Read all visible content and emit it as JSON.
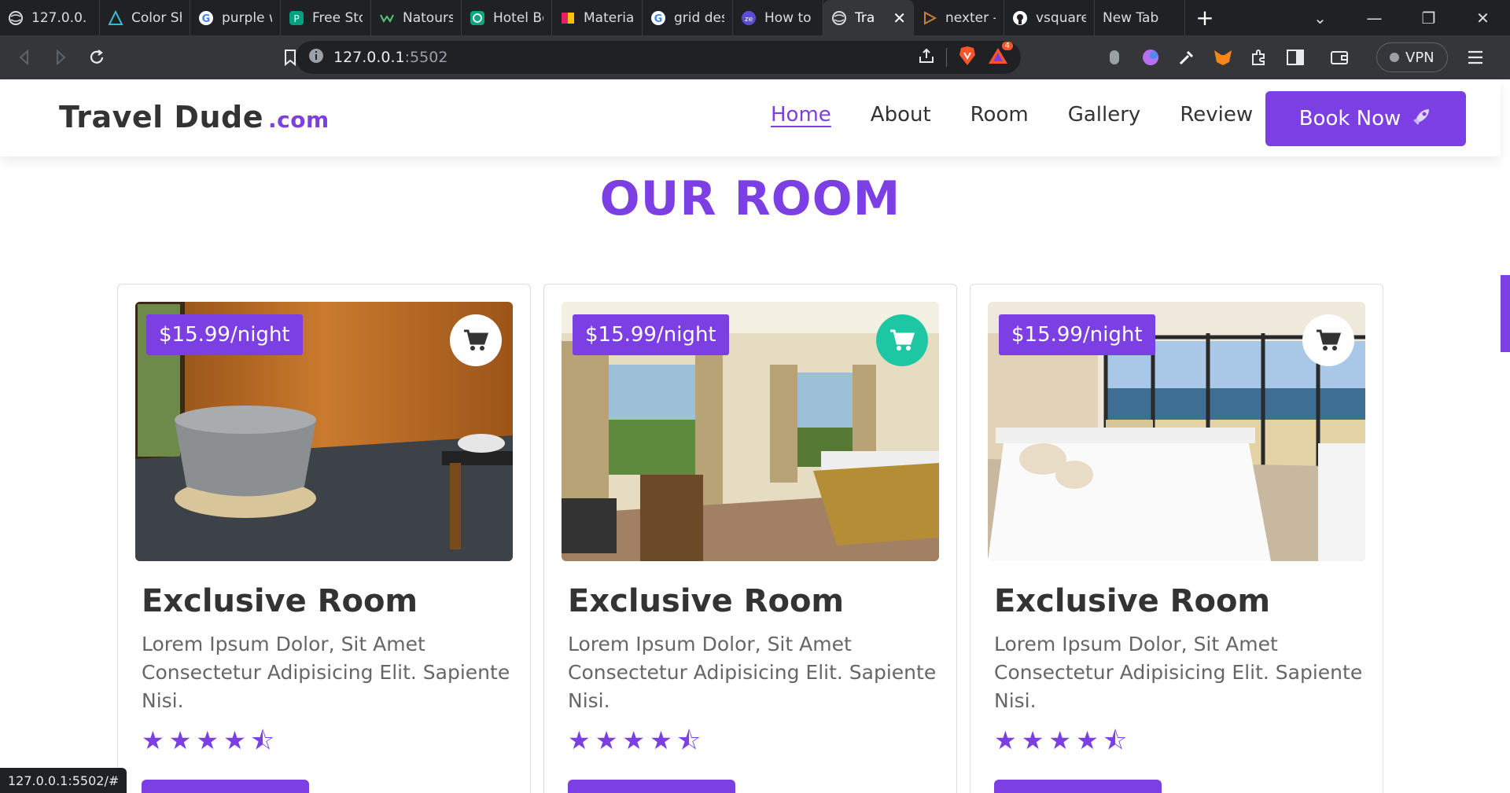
{
  "browser": {
    "tabs": [
      {
        "label": "127.0.0.",
        "icon": "globe-icon"
      },
      {
        "label": "Color Sh",
        "icon": "color-shades-icon"
      },
      {
        "label": "purple w",
        "icon": "google-icon"
      },
      {
        "label": "Free Sto",
        "icon": "pexels-icon"
      },
      {
        "label": "Natours",
        "icon": "natours-icon"
      },
      {
        "label": "Hotel Bo",
        "icon": "openai-icon"
      },
      {
        "label": "Materia",
        "icon": "material-icon"
      },
      {
        "label": "grid des",
        "icon": "google-icon"
      },
      {
        "label": "How to",
        "icon": "zeoob-icon"
      },
      {
        "label": "Tra",
        "icon": "globe-icon",
        "active": true
      },
      {
        "label": "nexter -",
        "icon": "play-icon"
      },
      {
        "label": "vsquare",
        "icon": "github-icon"
      },
      {
        "label": "New Tab",
        "icon": ""
      }
    ],
    "url_host": "127.0.0.1",
    "url_port": ":5502",
    "vpn_label": "VPN",
    "shields_badge": "4",
    "status_url": "127.0.0.1:5502/#"
  },
  "site": {
    "logo": "Travel Dude",
    "logo_suffix": ".com",
    "nav": [
      {
        "label": "Home",
        "active": true
      },
      {
        "label": "About"
      },
      {
        "label": "Room"
      },
      {
        "label": "Gallery"
      },
      {
        "label": "Review"
      }
    ],
    "book_now": "Book Now",
    "section_title": "OUR ROOM",
    "rooms": [
      {
        "price": "$15.99/night",
        "title": "Exclusive Room",
        "description": "Lorem Ipsum Dolor, Sit Amet Consectetur Adipisicing Elit. Sapiente Nisi.",
        "rating": 4.5,
        "image": "bathroom-photo"
      },
      {
        "price": "$15.99/night",
        "title": "Exclusive Room",
        "description": "Lorem Ipsum Dolor, Sit Amet Consectetur Adipisicing Elit. Sapiente Nisi.",
        "rating": 4.5,
        "image": "bedroom-balcony-photo"
      },
      {
        "price": "$15.99/night",
        "title": "Exclusive Room",
        "description": "Lorem Ipsum Dolor, Sit Amet Consectetur Adipisicing Elit. Sapiente Nisi.",
        "rating": 4.5,
        "image": "bedroom-ocean-view-photo"
      }
    ],
    "colors": {
      "accent": "#7b3fe4",
      "cart_hover": "#1ec7a3",
      "text": "#333333"
    }
  }
}
